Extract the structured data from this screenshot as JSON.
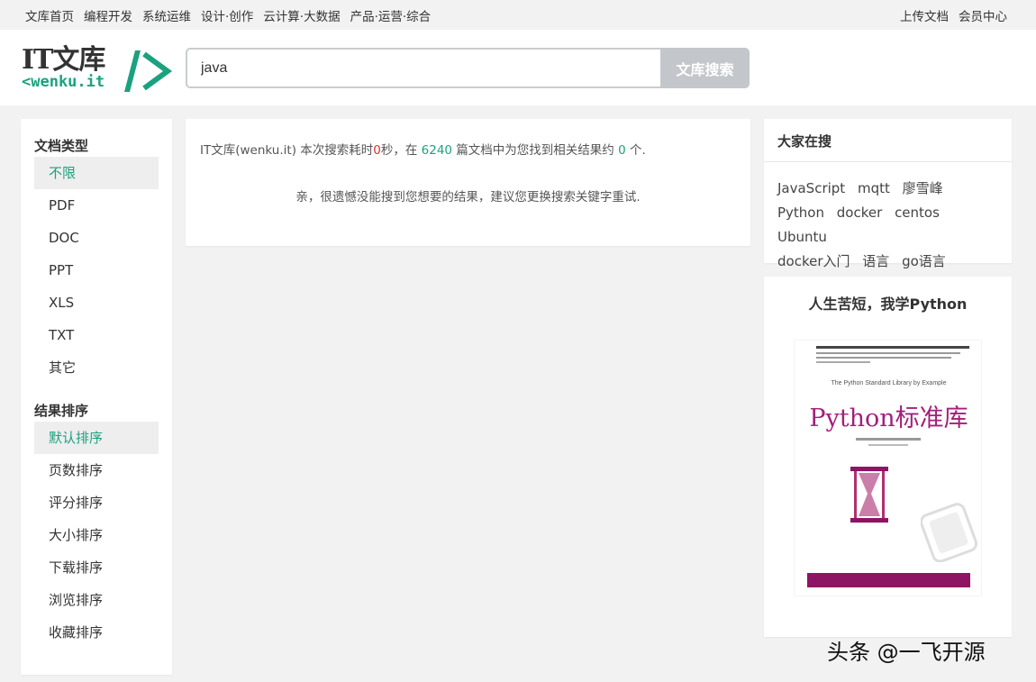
{
  "topnav": {
    "left": [
      "文库首页",
      "编程开发",
      "系统运维",
      "设计·创作",
      "云计算·大数据",
      "产品·运营·综合"
    ],
    "right": [
      "上传文档",
      "会员中心"
    ]
  },
  "logo": {
    "brand": "IT文库",
    "sub": "<wenku.it"
  },
  "search": {
    "query": "java",
    "button": "文库搜索"
  },
  "sidebar": {
    "type_heading": "文档类型",
    "types": [
      "不限",
      "PDF",
      "DOC",
      "PPT",
      "XLS",
      "TXT",
      "其它"
    ],
    "sort_heading": "结果排序",
    "sorts": [
      "默认排序",
      "页数排序",
      "评分排序",
      "大小排序",
      "下载排序",
      "浏览排序",
      "收藏排序"
    ]
  },
  "results": {
    "stats": {
      "prefix": "IT文库(wenku.it) 本次搜索耗时",
      "time": "0",
      "mid1": "秒，在 ",
      "doc_count": "6240",
      "mid2": " 篇文档中为您找到相关结果约 ",
      "result_count": "0",
      "suffix": " 个."
    },
    "empty_message": "亲，很遗憾没能搜到您想要的结果，建议您更换搜索关键字重试."
  },
  "hot": {
    "heading": "大家在搜",
    "tags": [
      "JavaScript",
      "mqtt",
      "廖雪峰",
      "Python",
      "docker",
      "centos",
      "Ubuntu",
      "docker入门",
      "语言",
      "go语言"
    ]
  },
  "promo": {
    "heading": "人生苦短，我学Python",
    "book_subtitle": "The Python Standard Library by Example",
    "book_title": "Python标准库"
  },
  "watermark": "头条 @一飞开源",
  "colors": {
    "accent": "#1aa27f",
    "highlight": "#e02d2d",
    "book": "#a31f7a"
  }
}
